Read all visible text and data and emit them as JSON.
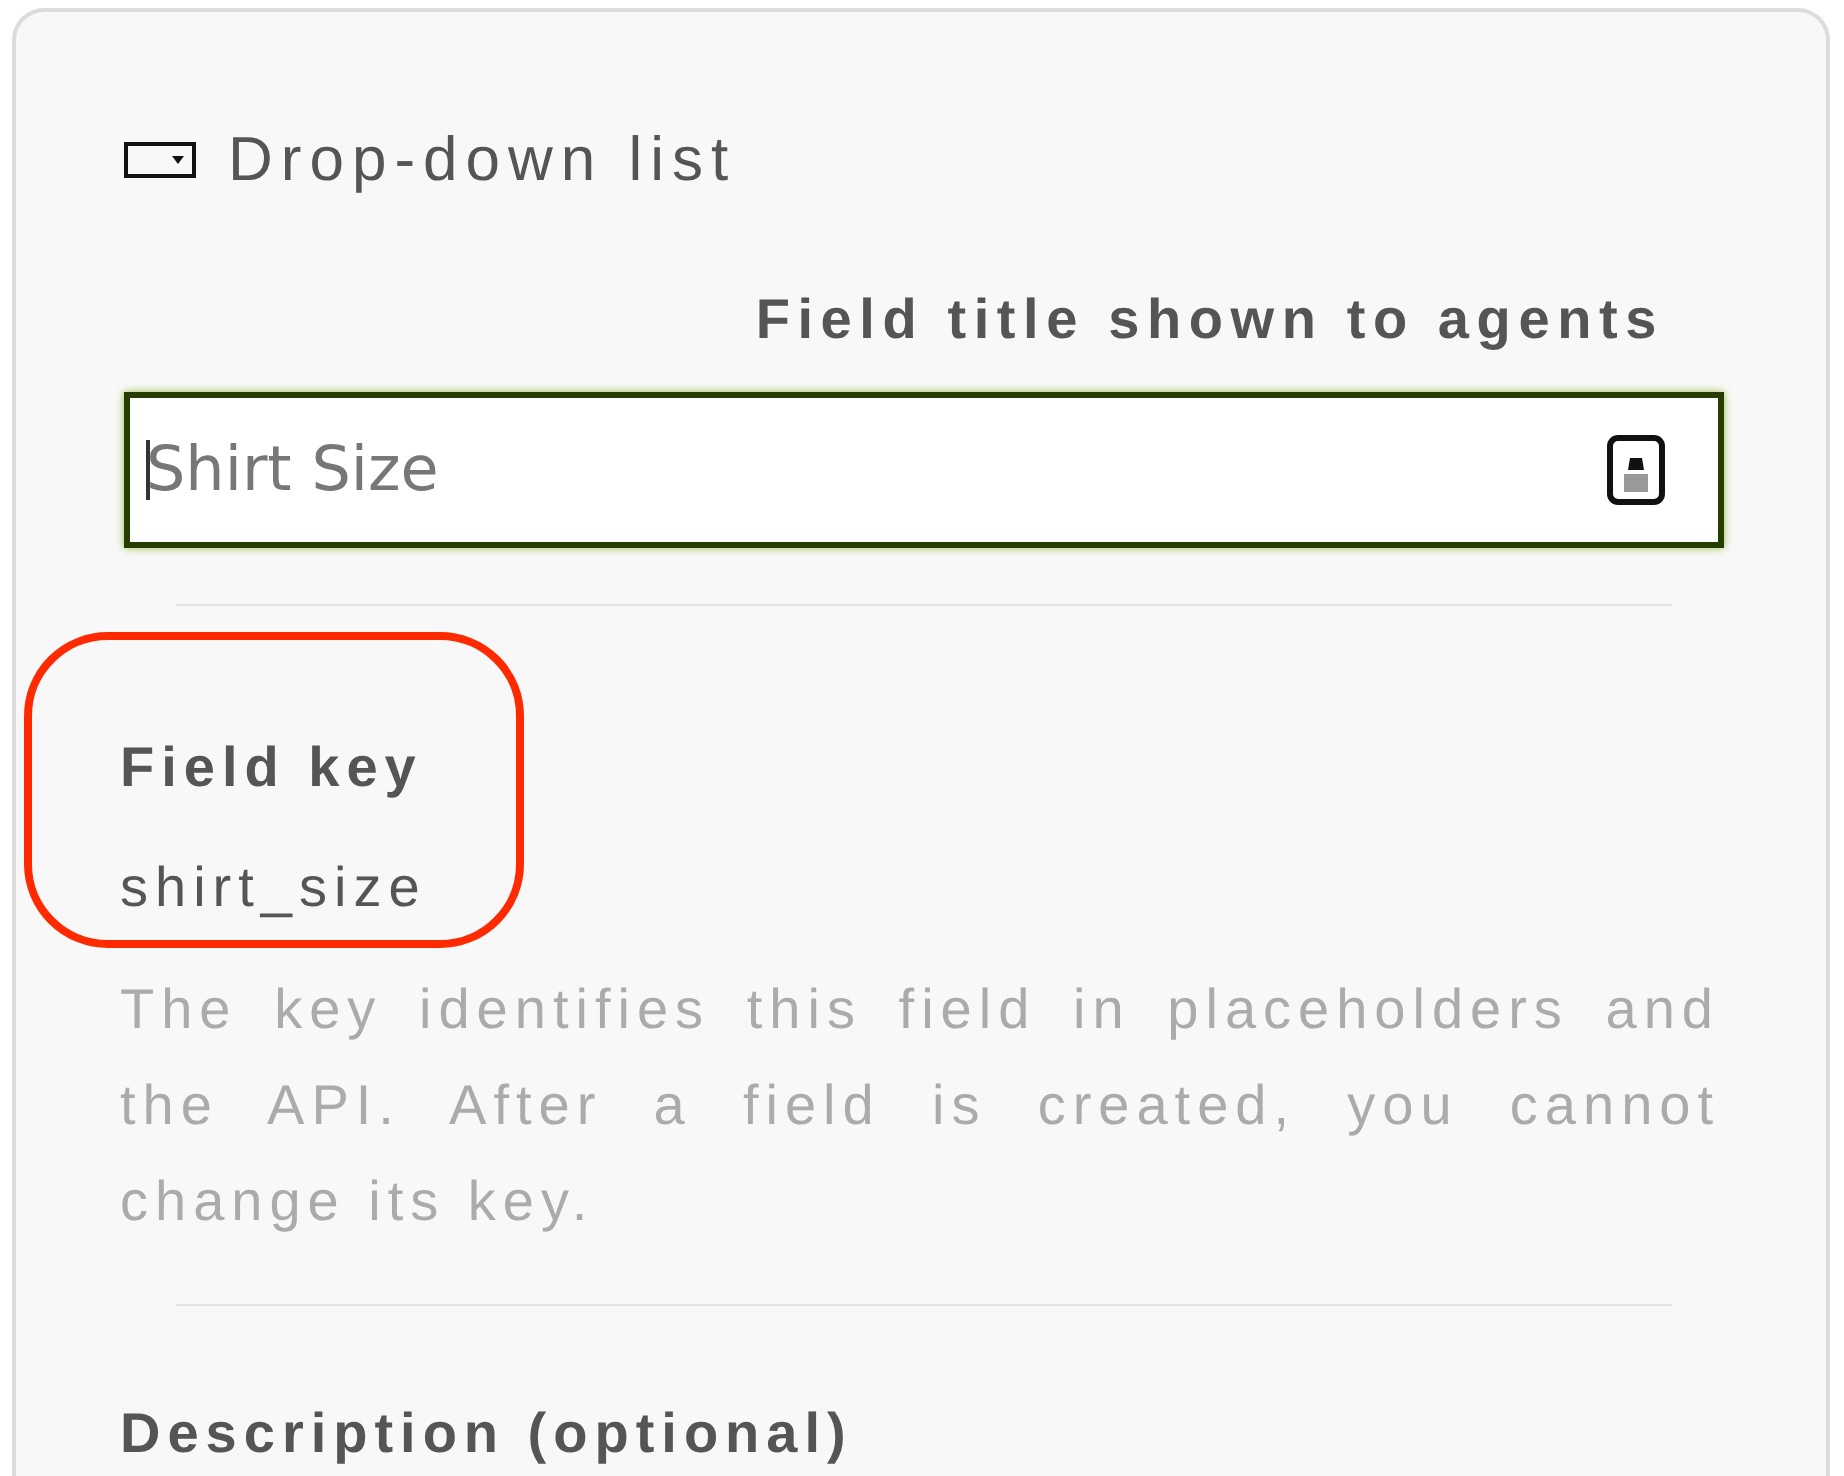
{
  "field_type": {
    "label": "Drop-down list"
  },
  "title_field": {
    "label": "Field title shown to agents",
    "value": "Shirt Size",
    "focused": true
  },
  "field_key": {
    "label": "Field key",
    "value": "shirt_size",
    "highlighted": true,
    "help": "The key identifies this field in placeholders and the API. After a field is created, you cannot change its key."
  },
  "description": {
    "label": "Description (optional)"
  }
}
